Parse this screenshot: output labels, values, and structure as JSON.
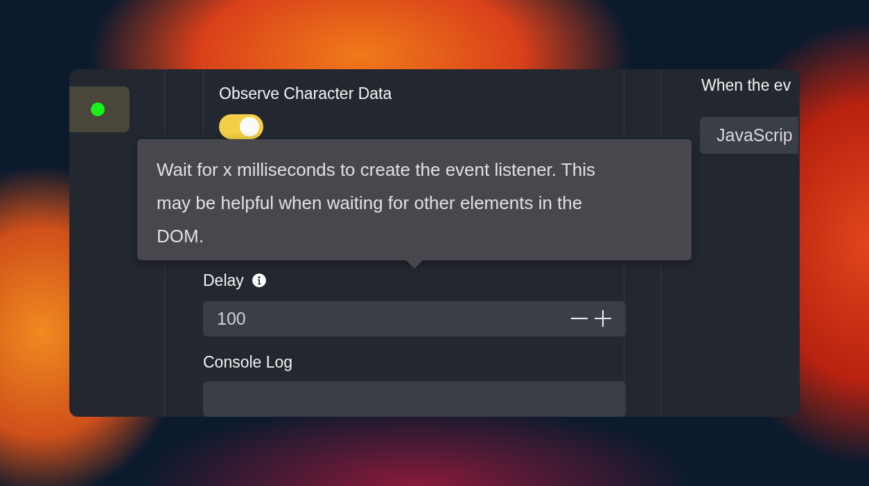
{
  "sidebar": {
    "items": [
      {
        "color": "#19f219",
        "selected": true
      }
    ]
  },
  "observe_character_data": {
    "label": "Observe Character Data",
    "on": true
  },
  "tooltip": {
    "text": "Wait for x milliseconds to create the event listener. This may be helpful when waiting for other elements in the DOM."
  },
  "delay": {
    "label": "Delay",
    "value": "100"
  },
  "console_log": {
    "label": "Console Log"
  },
  "right_panel": {
    "text": "When the ev",
    "button": "JavaScrip"
  }
}
